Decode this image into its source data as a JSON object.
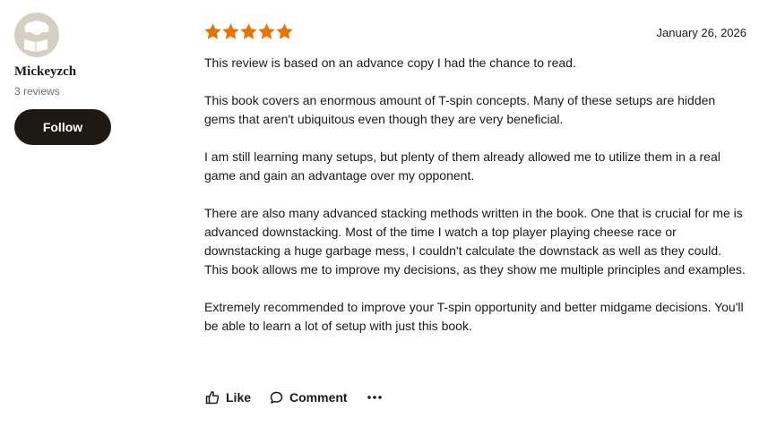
{
  "reviewer": {
    "name": "Mickeyzch",
    "review_count": "3 reviews",
    "follow_label": "Follow",
    "avatar_icon": "default-reader-avatar-icon"
  },
  "review": {
    "rating": 5,
    "rating_max": 5,
    "star_color": "#e87400",
    "date": "January 26, 2026",
    "paragraphs": [
      "This review is based on an advance copy I had the chance to read.",
      "This book covers an enormous amount of T-spin concepts. Many of these setups are hidden gems that aren't ubiquitous even though they are very beneficial.",
      "I am still learning many setups, but plenty of them already allowed me to utilize them in a real game and gain an advantage over my opponent.",
      "There are also many advanced stacking methods written in the book. One that is crucial for me is advanced downstacking. Most of the time I watch a top player playing cheese race or downstacking a huge garbage mess, I couldn't calculate the downstack as well as they could. This book allows me to improve my decisions, as they show me multiple principles and examples.",
      "Extremely recommended to improve your T-spin opportunity and better midgame decisions. You'll be able to learn a lot of setup with just this book."
    ]
  },
  "actions": {
    "like_label": "Like",
    "like_icon": "thumbs-up-icon",
    "comment_label": "Comment",
    "comment_icon": "speech-bubble-icon",
    "more_icon": "more-dots-icon"
  }
}
